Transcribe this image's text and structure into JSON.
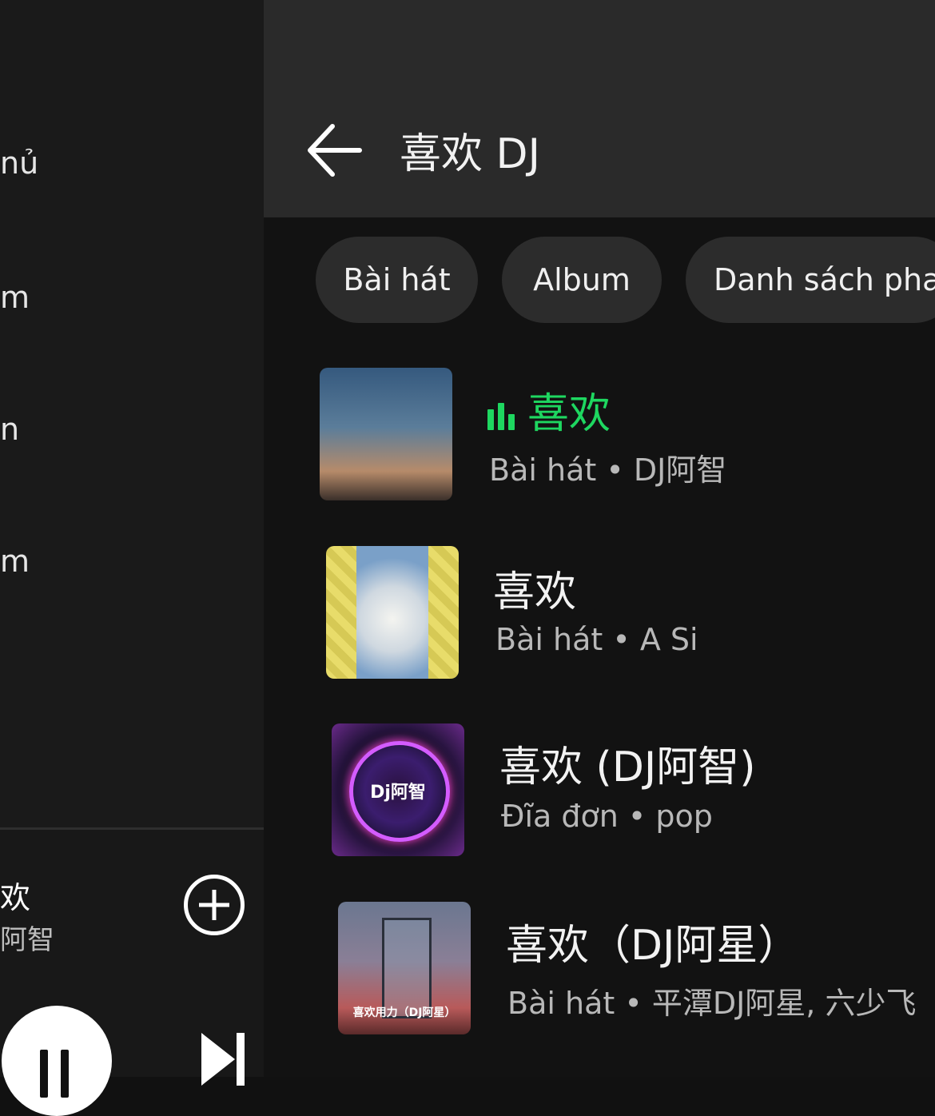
{
  "sidebar": {
    "items": [
      {
        "label": "nủ"
      },
      {
        "label": "m"
      },
      {
        "label": "n"
      },
      {
        "label": "m"
      }
    ]
  },
  "mini_player": {
    "title": "欢",
    "artist": "阿智",
    "add_icon": "plus-circle-icon",
    "pause_icon": "pause-icon",
    "next_icon": "skip-next-icon"
  },
  "header": {
    "back_icon": "arrow-left-icon",
    "title": "喜欢 DJ"
  },
  "filters": [
    {
      "label": "Bài hát"
    },
    {
      "label": "Album"
    },
    {
      "label": "Danh sách pha"
    }
  ],
  "results": [
    {
      "title": "喜欢",
      "subtitle": "Bài hát • DJ阿智",
      "playing": true
    },
    {
      "title": "喜欢",
      "subtitle": "Bài hát • A Si",
      "playing": false
    },
    {
      "title": "喜欢 (DJ阿智)",
      "subtitle": "Đĩa đơn • pop",
      "playing": false
    },
    {
      "title": "喜欢（DJ阿星）",
      "subtitle": "Bài hát • 平潭DJ阿星, 六少飞",
      "playing": false
    }
  ],
  "cover_text": {
    "result_3": "Dj阿智",
    "result_4": "喜欢用力（DJ阿星）"
  },
  "colors": {
    "accent_green": "#1ed760",
    "background": "#121212",
    "header": "#2a2a2a",
    "chip": "#2c2c2c"
  }
}
